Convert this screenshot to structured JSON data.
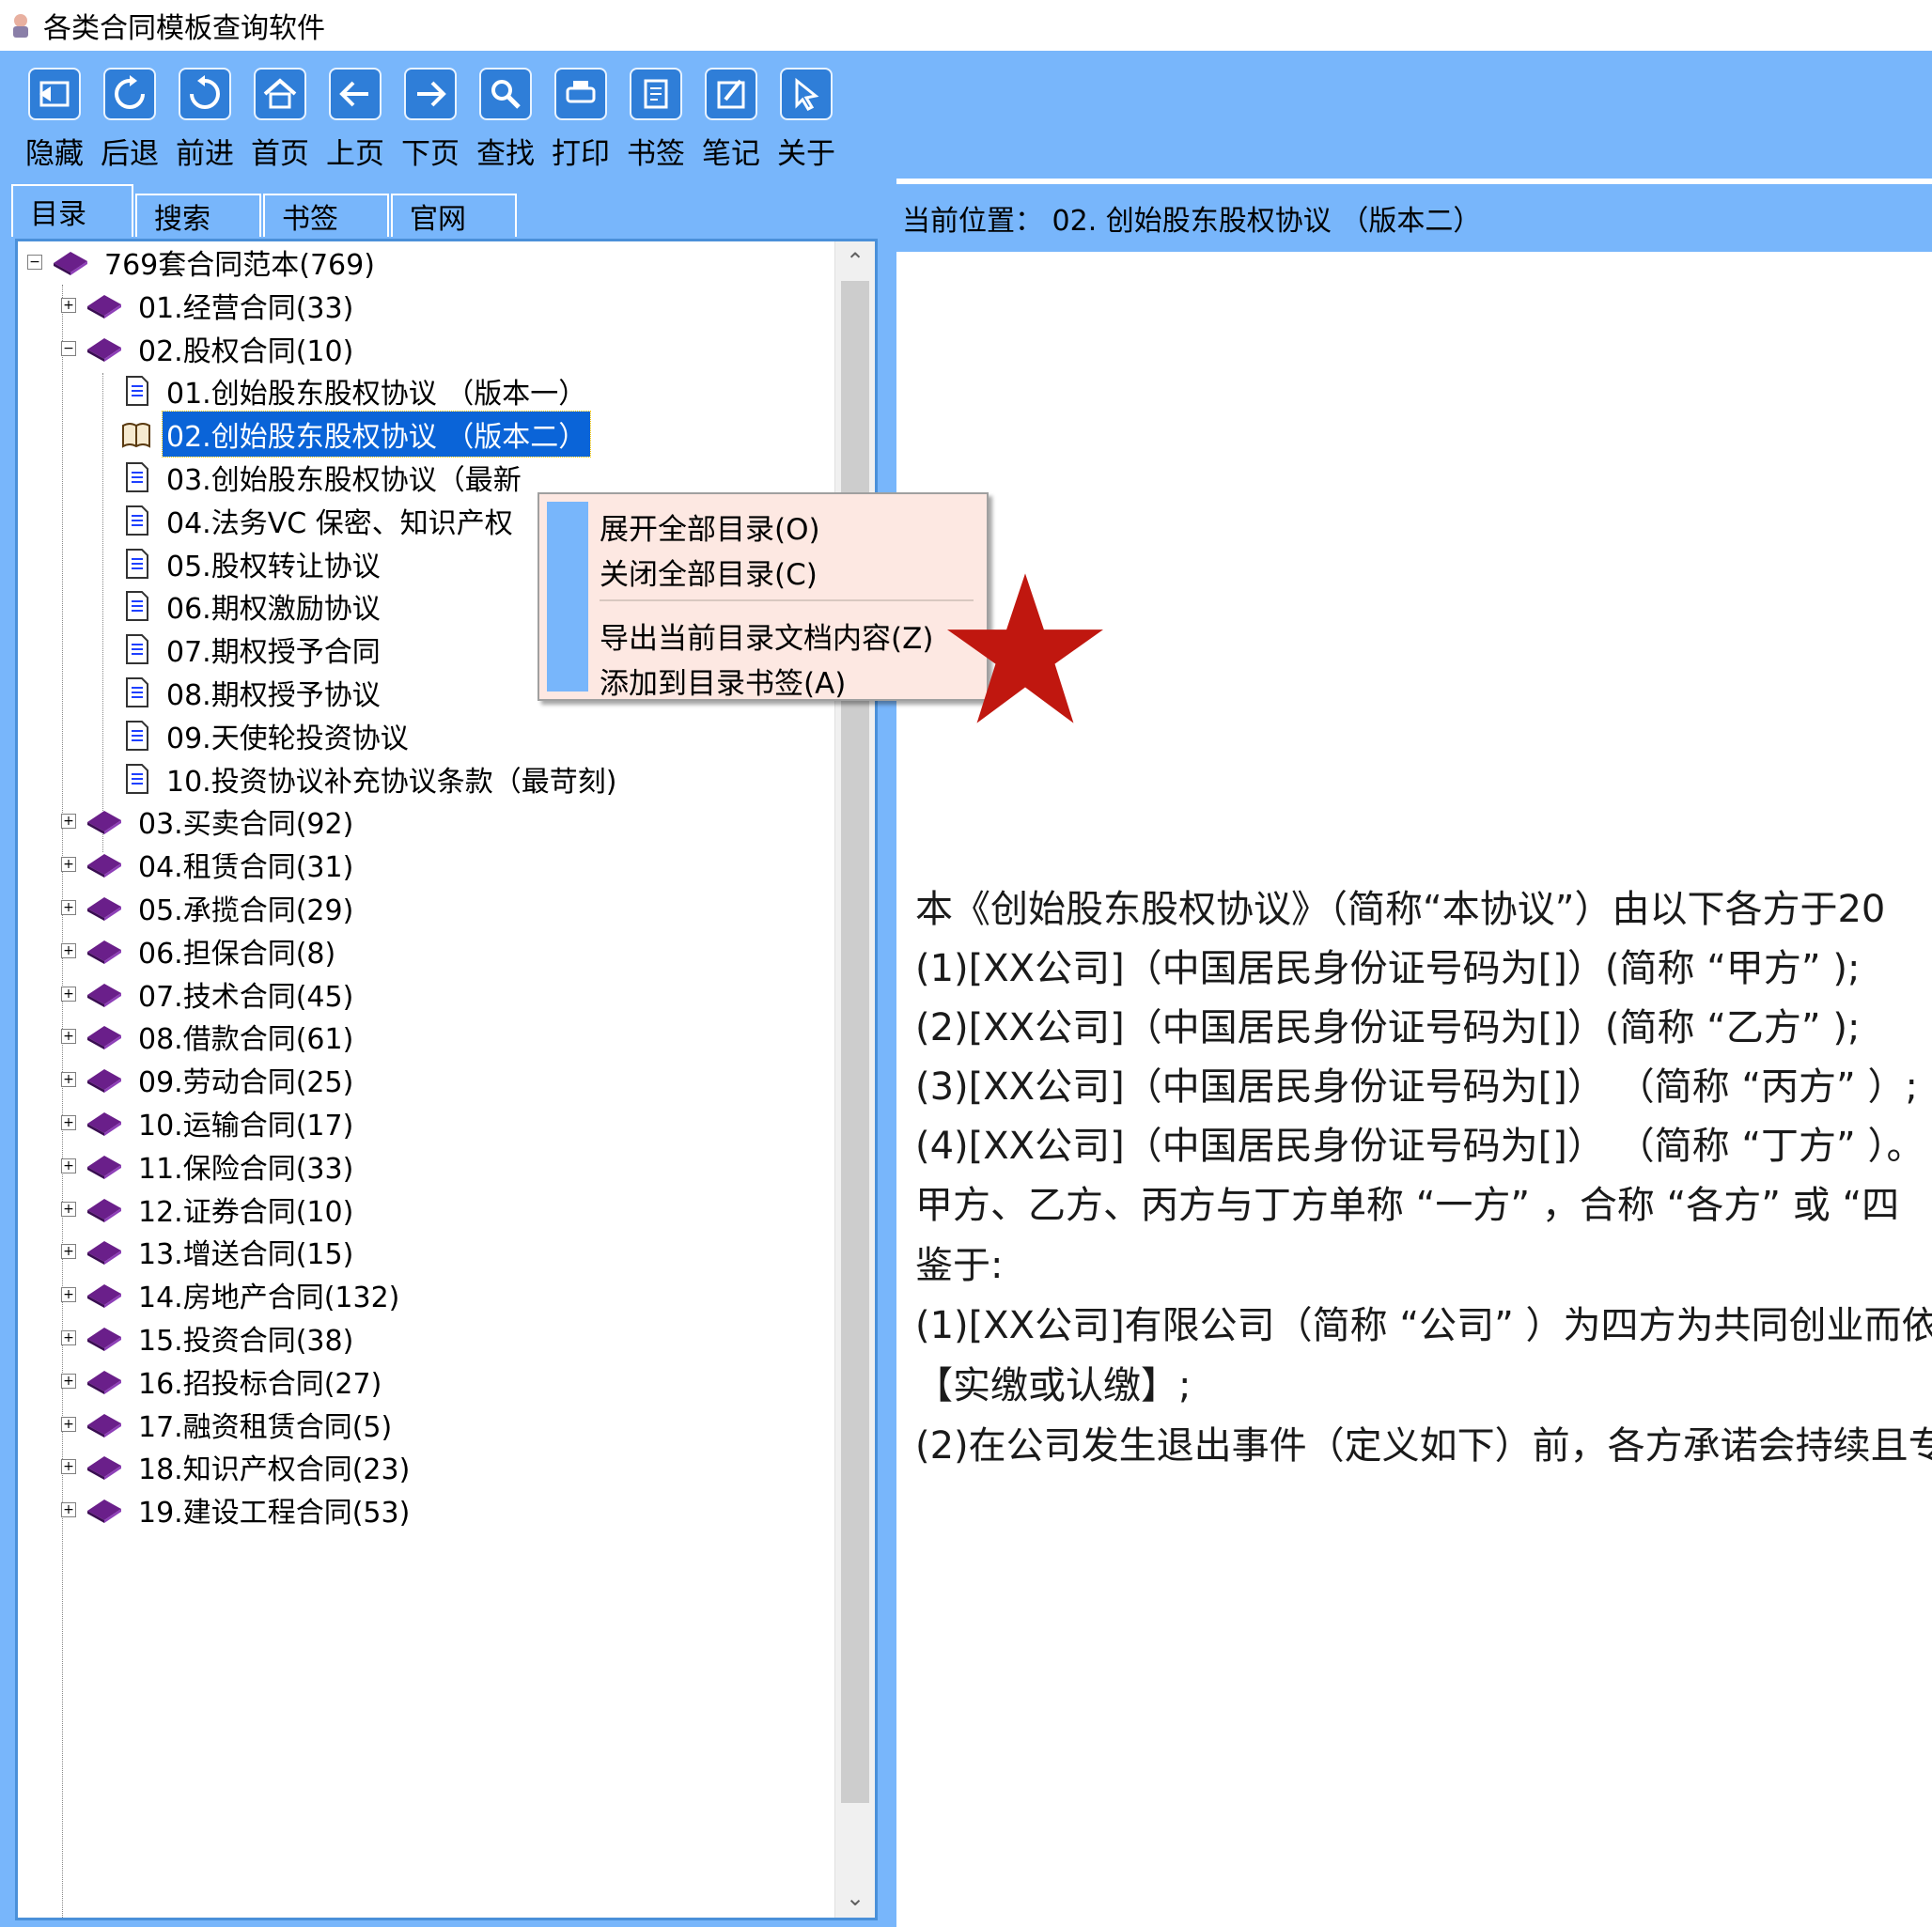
{
  "window": {
    "title": "各类合同模板查询软件"
  },
  "toolbar": {
    "buttons": [
      {
        "label": "隐藏",
        "icon": "hide-icon"
      },
      {
        "label": "后退",
        "icon": "refresh-back-icon"
      },
      {
        "label": "前进",
        "icon": "refresh-forward-icon"
      },
      {
        "label": "首页",
        "icon": "home-icon"
      },
      {
        "label": "上页",
        "icon": "arrow-left-icon"
      },
      {
        "label": "下页",
        "icon": "arrow-right-icon"
      },
      {
        "label": "查找",
        "icon": "search-icon"
      },
      {
        "label": "打印",
        "icon": "print-icon"
      },
      {
        "label": "书签",
        "icon": "bookmark-icon"
      },
      {
        "label": "笔记",
        "icon": "note-icon"
      },
      {
        "label": "关于",
        "icon": "cursor-icon"
      }
    ]
  },
  "tabs": [
    "目录",
    "搜索",
    "书签",
    "官网"
  ],
  "tree": {
    "root": "769套合同范本(769)",
    "categories_top": [
      "01.经营合同(33)",
      "02.股权合同(10)"
    ],
    "equity_children": [
      "01.创始股东股权协议 （版本一）",
      "02.创始股东股权协议 （版本二）",
      "03.创始股东股权协议（最新",
      "04.法务VC 保密、知识产权",
      "05.股权转让协议",
      "06.期权激励协议",
      "07.期权授予合同",
      "08.期权授予协议",
      "09.天使轮投资协议",
      "10.投资协议补充协议条款（最苛刻)"
    ],
    "categories_rest": [
      "03.买卖合同(92)",
      "04.租赁合同(31)",
      "05.承揽合同(29)",
      "06.担保合同(8)",
      "07.技术合同(45)",
      "08.借款合同(61)",
      "09.劳动合同(25)",
      "10.运输合同(17)",
      "11.保险合同(33)",
      "12.证券合同(10)",
      "13.增送合同(15)",
      "14.房地产合同(132)",
      "15.投资合同(38)",
      "16.招投标合同(27)",
      "17.融资租赁合同(5)",
      "18.知识产权合同(23)",
      "19.建设工程合同(53)"
    ]
  },
  "location": {
    "text": "当前位置：  02. 创始股东股权协议 （版本二）"
  },
  "context_menu": {
    "items": [
      "展开全部目录(O)",
      "关闭全部目录(C)",
      "导出当前目录文档内容(Z)",
      "添加到目录书签(A)"
    ]
  },
  "document": {
    "paragraphs": [
      "本《创始股东股权协议》（简称“本协议”）由以下各方于20",
      "(1)[XX公司]（中国居民身份证号码为[]）(简称 “甲方” );",
      "(2)[XX公司]（中国居民身份证号码为[]）(简称 “乙方” );",
      "(3)[XX公司]（中国居民身份证号码为[]） （简称 “丙方” ）;",
      "(4)[XX公司]（中国居民身份证号码为[]） （简称 “丁方” ）。",
      "甲方、乙方、丙方与丁方单称 “一方” ，合称 “各方” 或 “四",
      "鉴于:",
      "(1)[XX公司]有限公司（简称 “公司” ）为四方为共同创业而依",
      "【实缴或认缴】;",
      "(2)在公司发生退出事件（定义如下）前，各方承诺会持续且专"
    ]
  },
  "colors": {
    "accent": "#78b6fb",
    "selection": "#0a64d8",
    "menu_bg": "#fde8e2",
    "star": "#c0170f"
  }
}
